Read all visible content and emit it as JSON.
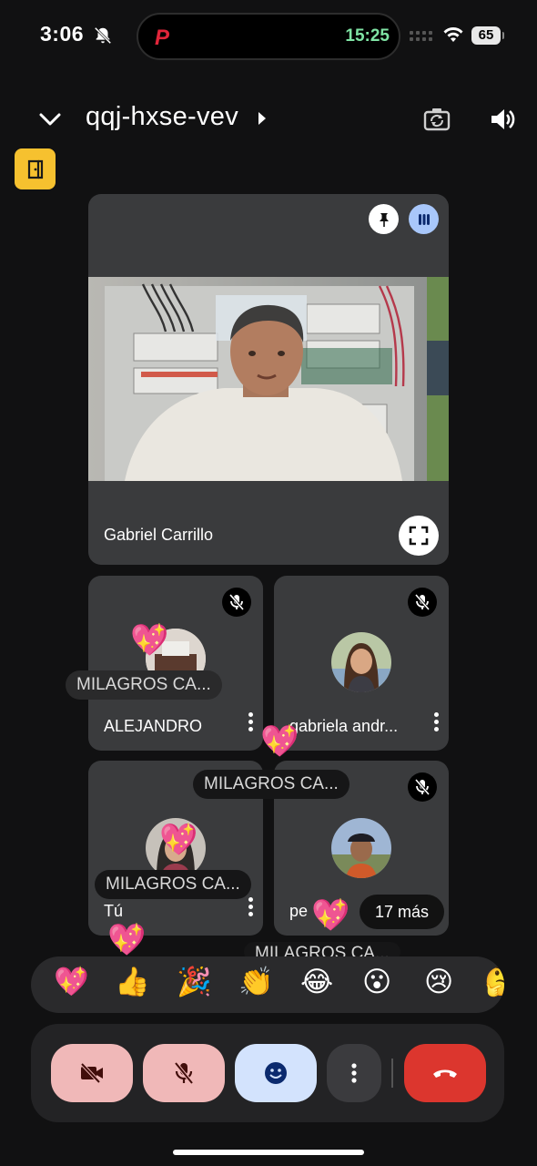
{
  "status_bar": {
    "time": "3:06",
    "island_time": "15:25",
    "island_app": "P",
    "battery": "65"
  },
  "header": {
    "meeting_code": "qqj-hxse-vev"
  },
  "featured": {
    "name": "Gabriel Carrillo"
  },
  "participants": [
    {
      "name": "ALEJANDRO",
      "muted": true
    },
    {
      "name": "gabriela andr...",
      "muted": true
    },
    {
      "name": "Tú",
      "muted": false
    },
    {
      "name": "pe",
      "muted": true
    }
  ],
  "more_label": "17 más",
  "reaction_labels": [
    "MILAGROS CA...",
    "MILAGROS CA...",
    "MILAGROS CA...",
    "MILAGROS CA..."
  ],
  "reactions": [
    "💖",
    "👍",
    "🎉",
    "👏",
    "😂",
    "😮",
    "😢",
    "🤔"
  ],
  "colors": {
    "room_button": "#f6c12f",
    "camera_off": "#f0b8b8",
    "reactions_active": "#d3e3fd",
    "end_call": "#dc362e"
  }
}
